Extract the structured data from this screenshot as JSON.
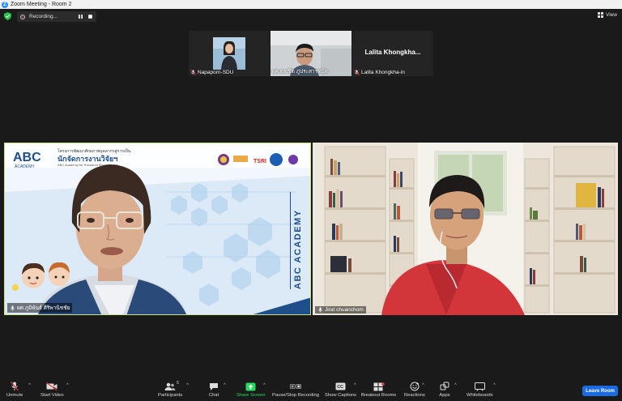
{
  "window": {
    "title": "Zoom Meeting - Room 2"
  },
  "topbar": {
    "recording_label": "Recording...",
    "view_label": "View"
  },
  "thumbnails": [
    {
      "name": "Napaporn-SDU",
      "muted": true
    },
    {
      "name": "ผศ.ดร.ชิต ภู่ประสารทมิต",
      "muted": true
    },
    {
      "name": "Lalita Khongkha-in",
      "muted": true,
      "display_text": "Lalita  Khongkha..."
    }
  ],
  "tiles": [
    {
      "name": "ผศ.ภูมิพันธ์ ศิริพานิชชัย",
      "slide_header": "โครงการพัฒนาศักยภาพบุคลากรสู่การเป็น",
      "slide_title": "นักจัดการงานวิจัยฯ",
      "slide_sub": "ABC Academy for Research Management",
      "logo_text": "ABC",
      "logo_sub": "ACADEMY",
      "side_text": "ABC ACADEMY"
    },
    {
      "name": "Jirat chuanchom"
    }
  ],
  "toolbar": {
    "unmute": "Unmute",
    "start_video": "Start Video",
    "participants": "Participants",
    "participants_count": "5",
    "chat": "Chat",
    "share_screen": "Share Screen",
    "pause_recording": "Pause/Stop Recording",
    "show_captions": "Show Captions",
    "breakout_rooms": "Breakout Rooms",
    "reactions": "Reactions",
    "apps": "Apps",
    "whiteboards": "Whiteboards",
    "leave_room": "Leave Room"
  },
  "colors": {
    "accent": "#2d8cff",
    "share_green": "#23d959",
    "active_speaker": "#c8e67a",
    "leave_blue": "#1a6be0",
    "muted_red": "#e33b3b"
  }
}
